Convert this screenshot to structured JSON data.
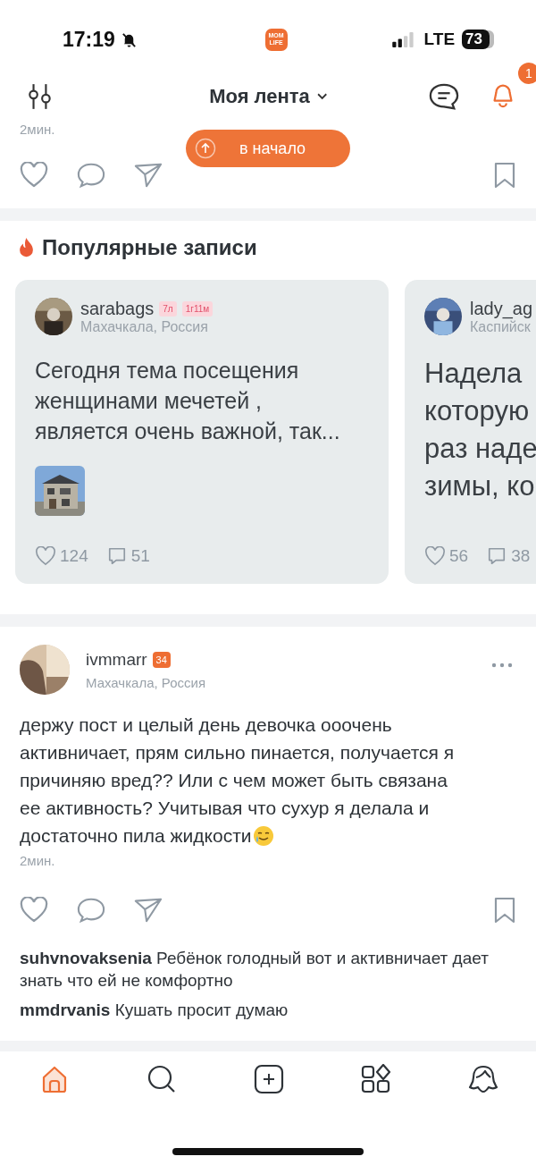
{
  "status_bar": {
    "time": "17:19",
    "app_logo": "MOM LIFE",
    "network": "LTE",
    "battery": "73"
  },
  "header": {
    "title": "Моя лента",
    "notifications": "1"
  },
  "previous_post": {
    "time": "2мин."
  },
  "scroll_top_button": "в начало",
  "popular": {
    "title": "Популярные записи",
    "cards": [
      {
        "username": "sarabags",
        "badges": [
          "7л",
          "1г11м"
        ],
        "location": "Махачкала, Россия",
        "text_lines": [
          "Сегодня тема посещения",
          "женщинами мечетей ,",
          "является очень важной, так..."
        ],
        "image": {
          "kind": "picture"
        },
        "likes": "124",
        "comments": "51"
      },
      {
        "username": "lady_ag",
        "location": "Каспийск",
        "text_lines": [
          "Надела",
          "которую",
          "раз наде",
          "зимы, ко"
        ],
        "likes": "56",
        "comments": "38"
      }
    ]
  },
  "post": {
    "username": "ivmmarr",
    "age_badge": "34",
    "location": "Махачкала, Россия",
    "text_lines": [
      "держу пост и целый день девочка ооочень",
      "активничает, прям сильно пинается, получается я",
      "причиняю вред?? Или с чем может быть связана",
      "ее активность? Учитывая что сухур я делала и",
      "достаточно пила жидкости"
    ],
    "time": "2мин.",
    "comments": [
      {
        "text": "**suhvnovaksenia** Ребёнок голодный вот и активничает дает знать что ей не комфортно"
      },
      {
        "text": "**mmdrvanis** Кушать просит думаю"
      }
    ]
  },
  "nav": [
    {
      "kind": "home",
      "selected": true
    },
    {
      "kind": "search",
      "selected": false
    },
    {
      "kind": "add",
      "selected": false
    },
    {
      "kind": "catalog",
      "selected": false
    },
    {
      "kind": "profile",
      "selected": false
    }
  ]
}
